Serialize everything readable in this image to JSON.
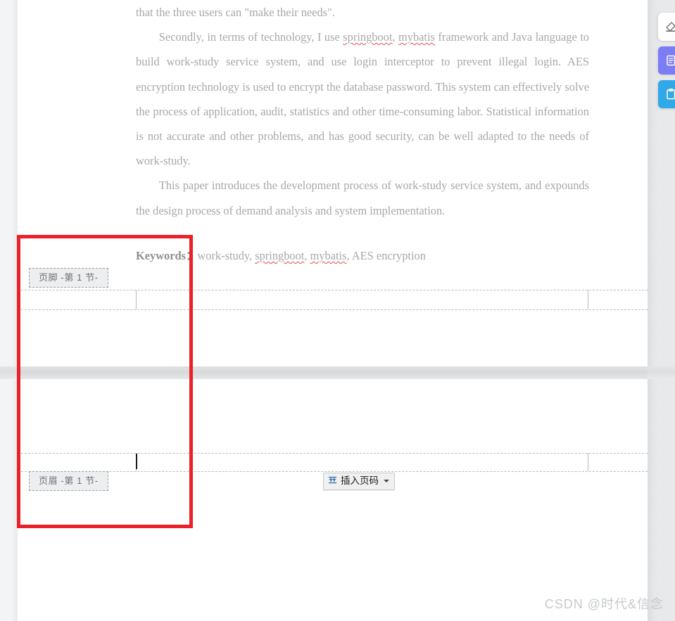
{
  "app": {
    "kind": "word-processor-document-view",
    "watermark": "CSDN @时代&信念"
  },
  "document": {
    "paragraphs": [
      {
        "id": "p-continuation",
        "indent": false,
        "runs": [
          {
            "text": "that the three users can \"make their needs\"."
          }
        ]
      },
      {
        "id": "p-secondly",
        "indent": true,
        "runs": [
          {
            "text": "Secondly, in terms of technology, I use "
          },
          {
            "text": "springboot",
            "spellcheck_error": true
          },
          {
            "text": ", "
          },
          {
            "text": "mybatis",
            "spellcheck_error": true
          },
          {
            "text": " framework and Java language to build work-study service system, and use login interceptor to prevent illegal login. AES encryption technology is used to encrypt the database password. This system can effectively solve the process of application, audit, statistics and other time-consuming labor. Statistical information is not accurate and other problems, and has good security, can be well adapted to the needs of work-study."
          }
        ]
      },
      {
        "id": "p-this-paper",
        "indent": true,
        "runs": [
          {
            "text": "This paper introduces the development process of work-study service system, and expounds the design process of demand analysis and system implementation."
          }
        ]
      }
    ],
    "keywords_line": {
      "label": "Keywords",
      "separator": "：",
      "value": "work-study, ",
      "terms": [
        {
          "text": "work-study",
          "spellcheck_error": false
        },
        {
          "text": "springboot",
          "spellcheck_error": true
        },
        {
          "text": "mybatis",
          "spellcheck_error": true
        },
        {
          "text": "AES encryption",
          "spellcheck_error": false
        }
      ],
      "full_text": "work-study, springboot, mybatis, AES encryption"
    }
  },
  "footer_region": {
    "tag_label": "页脚  -第 1 节-"
  },
  "header_region": {
    "tag_label": "页眉  -第 1 节-"
  },
  "page_number_control": {
    "icon": "insert-page-number-icon",
    "label": "插入页码",
    "dropdown_icon": "chevron-down-icon"
  },
  "annotation": {
    "shape": "rectangle",
    "color": "#ec2029",
    "stroke_width_px": 5
  },
  "floating_toolbar": {
    "buttons": [
      {
        "id": "eraser",
        "icon": "eraser-icon",
        "color": "#ffffff"
      },
      {
        "id": "note",
        "icon": "note-icon",
        "color": "#7c7cf5"
      },
      {
        "id": "clip",
        "icon": "clipboard-icon",
        "color": "#31a8e8"
      }
    ]
  }
}
